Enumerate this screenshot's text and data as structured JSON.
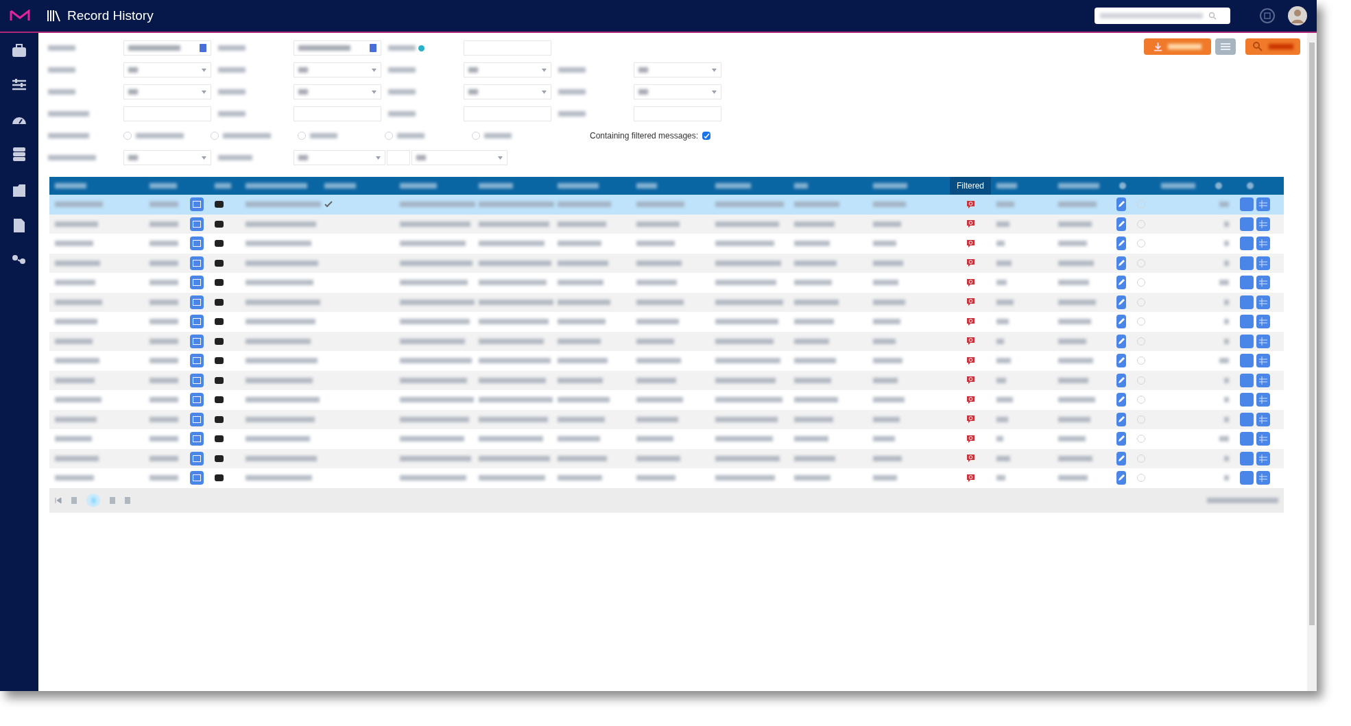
{
  "header": {
    "title": "Record History"
  },
  "filters": {
    "radios": [
      {
        "selected": false
      },
      {
        "selected": false
      },
      {
        "selected": false
      },
      {
        "selected": false
      },
      {
        "selected": false
      }
    ],
    "containing_filtered": {
      "label": "Containing filtered messages:",
      "checked": true
    }
  },
  "table": {
    "filtered_column": {
      "label": "Filtered",
      "selected": true
    },
    "rows": [
      {
        "selected": true,
        "pre_chat": true
      },
      {
        "selected": false,
        "pre_chat": false
      },
      {
        "selected": false,
        "pre_chat": false
      },
      {
        "selected": false,
        "pre_chat": false
      },
      {
        "selected": false,
        "pre_chat": false
      },
      {
        "selected": false,
        "pre_chat": false
      },
      {
        "selected": false,
        "pre_chat": false
      },
      {
        "selected": false,
        "pre_chat": false
      },
      {
        "selected": false,
        "pre_chat": false
      },
      {
        "selected": false,
        "pre_chat": false
      },
      {
        "selected": false,
        "pre_chat": false
      },
      {
        "selected": false,
        "pre_chat": false
      },
      {
        "selected": false,
        "pre_chat": false
      },
      {
        "selected": false,
        "pre_chat": false
      },
      {
        "selected": false,
        "pre_chat": false
      }
    ]
  }
}
